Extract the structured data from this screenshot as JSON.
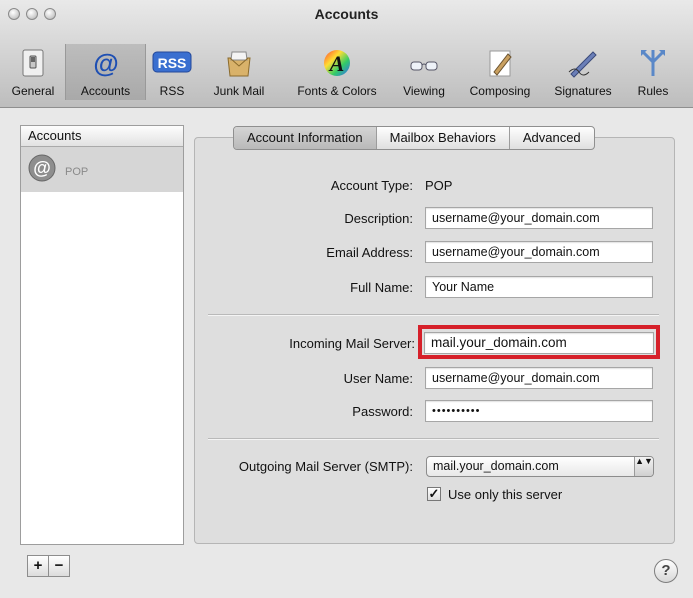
{
  "window": {
    "title": "Accounts"
  },
  "toolbar": {
    "items": [
      {
        "label": "General",
        "icon": "switch-icon"
      },
      {
        "label": "Accounts",
        "icon": "at-sign-icon",
        "glyph": "@"
      },
      {
        "label": "RSS",
        "icon": "rss-icon",
        "glyph": "RSS"
      },
      {
        "label": "Junk Mail",
        "icon": "junk-mail-icon"
      },
      {
        "label": "Fonts & Colors",
        "icon": "fonts-colors-icon",
        "glyph": "A"
      },
      {
        "label": "Viewing",
        "icon": "glasses-icon"
      },
      {
        "label": "Composing",
        "icon": "pencil-paper-icon"
      },
      {
        "label": "Signatures",
        "icon": "pen-icon"
      },
      {
        "label": "Rules",
        "icon": "rules-icon"
      }
    ],
    "active_index": 1
  },
  "accounts_list": {
    "header": "Accounts",
    "items": [
      {
        "type": "POP",
        "icon": "at-sign-icon",
        "glyph": "@"
      }
    ]
  },
  "list_controls": {
    "add": "+",
    "remove": "−"
  },
  "tabs": [
    {
      "label": "Account Information",
      "active": true
    },
    {
      "label": "Mailbox Behaviors",
      "active": false
    },
    {
      "label": "Advanced",
      "active": false
    }
  ],
  "form": {
    "account_type_label": "Account Type:",
    "account_type_value": "POP",
    "description_label": "Description:",
    "description_value": "username@your_domain.com",
    "email_label": "Email Address:",
    "email_value": "username@your_domain.com",
    "full_name_label": "Full Name:",
    "full_name_value": "Your Name",
    "incoming_label": "Incoming Mail Server:",
    "incoming_value": "mail.your_domain.com",
    "username_label": "User Name:",
    "username_value": "username@your_domain.com",
    "password_label": "Password:",
    "password_value": "••••••••••",
    "outgoing_label": "Outgoing Mail Server (SMTP):",
    "outgoing_value": "mail.your_domain.com",
    "select_arrows": "▲▼",
    "use_only_label": "Use only this server",
    "use_only_checked": true,
    "checkmark": "✓"
  },
  "help": {
    "glyph": "?"
  },
  "colors": {
    "highlight": "#d6202a",
    "rss_blue": "#3a6fd0"
  }
}
